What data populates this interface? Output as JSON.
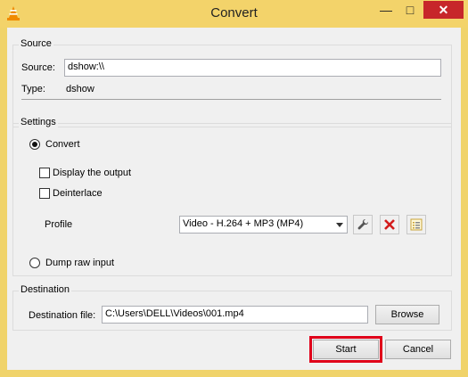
{
  "window": {
    "title": "Convert"
  },
  "source": {
    "group_label": "Source",
    "source_label": "Source:",
    "source_value": "dshow:\\\\",
    "type_label": "Type:",
    "type_value": "dshow"
  },
  "settings": {
    "group_label": "Settings",
    "convert_label": "Convert",
    "display_output_label": "Display the output",
    "deinterlace_label": "Deinterlace",
    "profile_label": "Profile",
    "profile_value": "Video - H.264 + MP3 (MP4)",
    "dump_raw_label": "Dump raw input"
  },
  "destination": {
    "group_label": "Destination",
    "file_label": "Destination file:",
    "file_value": "C:\\Users\\DELL\\Videos\\001.mp4",
    "browse_label": "Browse"
  },
  "buttons": {
    "start_label": "Start",
    "cancel_label": "Cancel"
  },
  "colors": {
    "titlebar": "#f3d36a",
    "highlight": "#e0001a",
    "close": "#c7262a"
  }
}
